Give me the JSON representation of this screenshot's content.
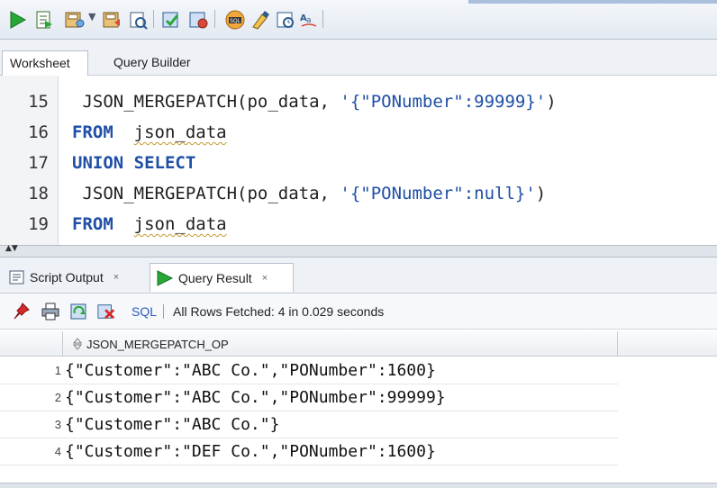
{
  "toolbar": {
    "icons": [
      "run-statement-icon",
      "run-script-icon",
      "commit-icon",
      "rollback-icon",
      "autotrace-icon",
      "explain-plan-icon",
      "sql-tuning-icon",
      "clear-icon",
      "history-icon",
      "format-icon"
    ]
  },
  "worksheet_tabs": [
    {
      "label": "Worksheet",
      "active": true
    },
    {
      "label": "Query Builder",
      "active": false
    }
  ],
  "editor": {
    "lines": [
      {
        "num": "15",
        "tokens": [
          {
            "t": " JSON_MERGEPATCH(po_data, ",
            "c": "fn"
          },
          {
            "t": "'{\"PONumber\":99999}'",
            "c": "str"
          },
          {
            "t": ")",
            "c": "fn"
          }
        ]
      },
      {
        "num": "16",
        "tokens": [
          {
            "t": "FROM",
            "c": "kw"
          },
          {
            "t": "  ",
            "c": "fn"
          },
          {
            "t": "json_data",
            "c": "fn ws-underline"
          }
        ]
      },
      {
        "num": "17",
        "tokens": [
          {
            "t": "UNION SELECT",
            "c": "kw"
          }
        ]
      },
      {
        "num": "18",
        "tokens": [
          {
            "t": " JSON_MERGEPATCH(po_data, ",
            "c": "fn"
          },
          {
            "t": "'{\"PONumber\":null}'",
            "c": "str"
          },
          {
            "t": ")",
            "c": "fn"
          }
        ]
      },
      {
        "num": "19",
        "tokens": [
          {
            "t": "FROM",
            "c": "kw"
          },
          {
            "t": "  ",
            "c": "fn"
          },
          {
            "t": "json_data",
            "c": "fn ws-underline"
          }
        ]
      }
    ]
  },
  "output_tabs": [
    {
      "label": "Script Output",
      "close": "×",
      "active": false
    },
    {
      "label": "Query Result",
      "close": "×",
      "active": true
    }
  ],
  "result_toolbar": {
    "sql_label": "SQL",
    "status": "All Rows Fetched: 4 in 0.029 seconds"
  },
  "grid": {
    "column": "JSON_MERGEPATCH_OP",
    "rows": [
      {
        "num": "1",
        "value": "{\"Customer\":\"ABC Co.\",\"PONumber\":1600}"
      },
      {
        "num": "2",
        "value": "{\"Customer\":\"ABC Co.\",\"PONumber\":99999}"
      },
      {
        "num": "3",
        "value": "{\"Customer\":\"ABC Co.\"}"
      },
      {
        "num": "4",
        "value": "{\"Customer\":\"DEF Co.\",\"PONumber\":1600}"
      }
    ]
  }
}
